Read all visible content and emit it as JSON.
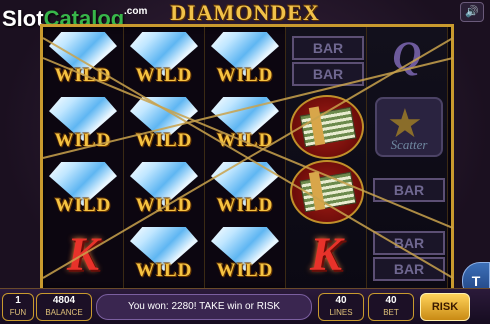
{
  "header": {
    "logo_text_white": "Slot",
    "logo_text_green": "Catalog",
    "logo_suffix": ".com",
    "game_title": "DIAMONDEX",
    "sound_icon": "speaker-icon"
  },
  "reels": [
    [
      {
        "type": "wild",
        "label": "WILD"
      },
      {
        "type": "wild",
        "label": "WILD"
      },
      {
        "type": "wild",
        "label": "WILD"
      },
      {
        "type": "k",
        "label": "K"
      }
    ],
    [
      {
        "type": "wild",
        "label": "WILD"
      },
      {
        "type": "wild",
        "label": "WILD"
      },
      {
        "type": "wild",
        "label": "WILD"
      },
      {
        "type": "wild",
        "label": "WILD"
      }
    ],
    [
      {
        "type": "wild",
        "label": "WILD"
      },
      {
        "type": "wild",
        "label": "WILD"
      },
      {
        "type": "wild",
        "label": "WILD"
      },
      {
        "type": "wild",
        "label": "WILD"
      }
    ],
    [
      {
        "type": "bar2",
        "label": "BAR"
      },
      {
        "type": "money",
        "label": ""
      },
      {
        "type": "money",
        "label": ""
      },
      {
        "type": "k",
        "label": "K"
      }
    ],
    [
      {
        "type": "q",
        "label": "Q"
      },
      {
        "type": "scatter",
        "label": "Scatter"
      },
      {
        "type": "bar1",
        "label": "BAR"
      },
      {
        "type": "bar2",
        "label": "BAR"
      }
    ]
  ],
  "bottom_bar": {
    "fun": {
      "value": "1",
      "label": "FUN"
    },
    "balance": {
      "value": "4804",
      "label": "BALANCE"
    },
    "message": "You won: 2280! TAKE win or RISK",
    "lines": {
      "value": "40",
      "label": "LINES"
    },
    "bet": {
      "value": "40",
      "label": "BET"
    },
    "risk_label": "RISK",
    "side_label": "T"
  },
  "colors": {
    "gold": "#c99a2e",
    "wild_text": "#f5c342",
    "k_red": "#e8322a",
    "risk_button": "#ffd35a"
  }
}
